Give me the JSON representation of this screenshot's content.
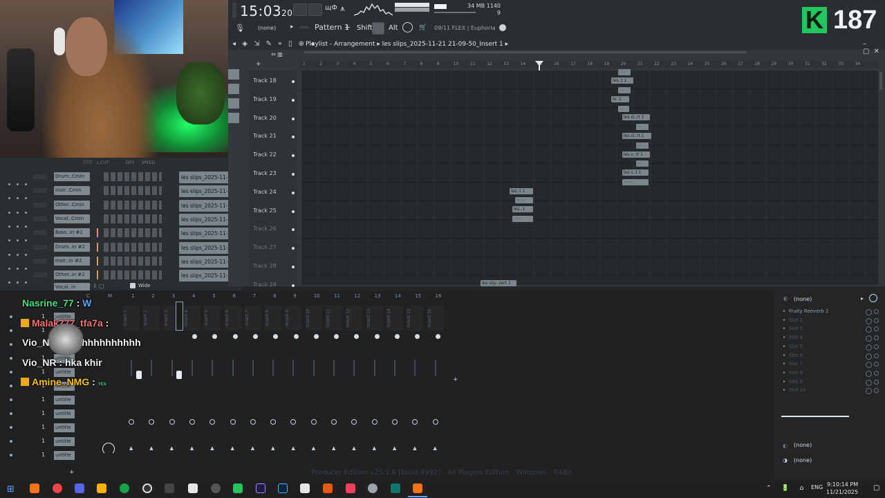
{
  "app": {
    "clock": "15:03",
    "clock_sub": "20",
    "tempo": "34",
    "memory": "1140 MB",
    "memory_sub": "9",
    "pattern": "Pattern 1",
    "shift": "Shift",
    "alt": "Alt",
    "none_label": "(none)",
    "preset_info": "09/11 FLEX | Euphoria",
    "playlist_title": "Playlist - Arrangement",
    "playlist_path": "les slips_2025-11-21 21-09-50_Insert 1",
    "version_text": "Producer Edition v25.1.6 [build 4992] - All Plugins Edition - Windows - 64Bit"
  },
  "stream": {
    "badge": "K",
    "viewer_count": "187"
  },
  "rack": {
    "header": [
      "L.CUT",
      "DIFF",
      "SPEED"
    ],
    "channels": [
      {
        "name": "Drum..Cmin",
        "clip": "les slips_2025-11-21 21-"
      },
      {
        "name": "Instr..Cmin",
        "clip": "les slips_2025-11-21 21-"
      },
      {
        "name": "Other..Cmin",
        "clip": "les slips_2025-11-21 21-"
      },
      {
        "name": "Vocal..Cmin",
        "clip": "les slips_2025-11-21 21-"
      },
      {
        "name": "Bass..in #2",
        "clip": "les slips_2025-11-21 21-"
      },
      {
        "name": "Drum..in #2",
        "clip": "les slips_2025-11-21 21-"
      },
      {
        "name": "Instr..in #2",
        "clip": "les slips_2025-11-21 21-"
      },
      {
        "name": "Other..in #2",
        "clip": "les slips_2025-11-21 21-"
      }
    ],
    "bottom_row": {
      "name": "Vocal..in",
      "wide": "Wide"
    }
  },
  "playlist": {
    "ruler": [
      "1",
      "2",
      "3",
      "4",
      "5",
      "6",
      "7",
      "8",
      "9",
      "10",
      "11",
      "12",
      "13",
      "14",
      "15",
      "16",
      "17",
      "18",
      "19",
      "20",
      "21",
      "22",
      "23",
      "24",
      "25",
      "26",
      "27",
      "28",
      "29",
      "30",
      "31",
      "32",
      "33",
      "34"
    ],
    "tracks": [
      "Track 18",
      "Track 19",
      "Track 20",
      "Track 21",
      "Track 22",
      "Track 23",
      "Track 24",
      "Track 25",
      "Track 26",
      "Track 27",
      "Track 28",
      "Track 29"
    ],
    "clips": {
      "c1": "les..t 1",
      "c2": "le..1",
      "c3": "les sl..rt 1",
      "c4": "les sl..rt 1",
      "c5": "les s..rt 1",
      "c6": "les s..t 1",
      "c7": "les..t 1",
      "c8": "les..1",
      "c9": "les slip..sert 1"
    }
  },
  "mixer": {
    "headers": [
      "C",
      "M",
      "1",
      "2",
      "3",
      "4",
      "5",
      "6",
      "7",
      "8",
      "9",
      "10",
      "11",
      "12",
      "13",
      "14",
      "15",
      "16"
    ],
    "inserts": [
      "Insert 1",
      "Insert 2",
      "Insert 3",
      "Insert 4",
      "Insert 5",
      "Insert 6",
      "Insert 7",
      "Insert 8",
      "Insert 9",
      "Insert 10",
      "Insert 11",
      "Insert 12",
      "Insert 13",
      "Insert 14",
      "Insert 15",
      "Insert 16"
    ],
    "left_labels": [
      "untitle",
      "untitle",
      "untitle",
      "untitle",
      "untitle",
      "untitle",
      "untitle",
      "untitle",
      "untitle",
      "untitle",
      "untitle"
    ]
  },
  "chat": [
    {
      "user": "Nasrine_77",
      "msg": "W",
      "user_color": "#4ade80",
      "msg_color": "#60a5fa",
      "badge": false
    },
    {
      "user": "Malak777_tfa7a",
      "msg": "",
      "user_color": "#f87171",
      "msg_color": "#f2f3f4",
      "badge": true
    },
    {
      "user": "Vio_N",
      "msg": "hhhhhhhhhhhhhh",
      "user_color": "#f2f3f4",
      "msg_color": "#f2f3f4",
      "badge": false
    },
    {
      "user": "Vio_NR",
      "msg": "hka khir",
      "user_color": "#f2f3f4",
      "msg_color": "#f2f3f4",
      "badge": false
    },
    {
      "user": "Amine_NMG",
      "msg": "YES",
      "user_color": "#fbbf24",
      "msg_color": "#4ade80",
      "badge": true
    }
  ],
  "fx": {
    "top": "(none)",
    "slots": [
      "Fruity Reeverb 2",
      "Slot 2",
      "Slot 3",
      "Slot 4",
      "Slot 5",
      "Slot 6",
      "Slot 7",
      "Slot 8",
      "Slot 9",
      "Slot 10"
    ],
    "bottom1": "(none)",
    "bottom2": "(none)"
  },
  "taskbar": {
    "lang": "ENG",
    "time": "9:10:14 PM",
    "date": "11/21/2025"
  }
}
